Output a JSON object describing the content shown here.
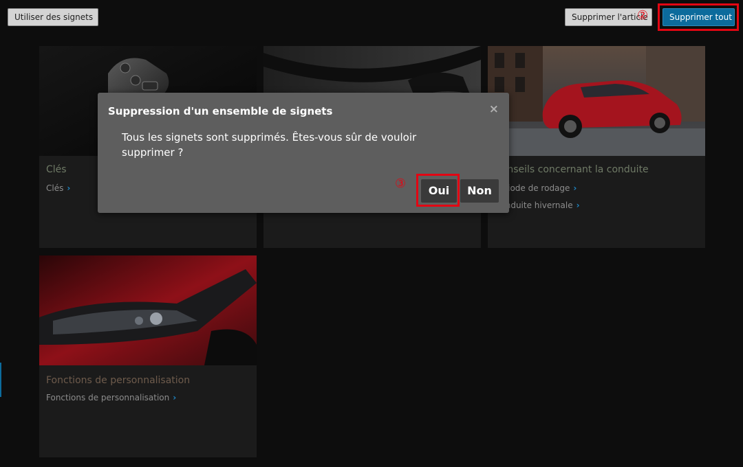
{
  "toolbar": {
    "use_bookmarks": "Utiliser des signets",
    "delete_item": "Supprimer l'article",
    "delete_all": "Supprimer tout"
  },
  "annotations": {
    "step_2": "②",
    "step_3": "③"
  },
  "cards": [
    {
      "title": "Clés",
      "links": [
        "Clés"
      ]
    },
    {
      "title": "",
      "links": []
    },
    {
      "title": "Conseils concernant la conduite",
      "links": [
        "Période de rodage",
        "Conduite hivernale"
      ]
    },
    {
      "title": "Fonctions de personnalisation",
      "links": [
        "Fonctions de personnalisation"
      ]
    }
  ],
  "dialog": {
    "title": "Suppression d'un ensemble de signets",
    "close": "×",
    "message": "Tous les signets sont supprimés. Êtes-vous sûr de vouloir supprimer ?",
    "yes": "Oui",
    "no": "Non"
  },
  "icons": {
    "chevron": "chevron-right-icon",
    "close": "close-icon"
  },
  "colors": {
    "accent_blue": "#0c6b9c",
    "highlight_red": "#e30613",
    "dialog_bg": "#5e5e5e"
  }
}
